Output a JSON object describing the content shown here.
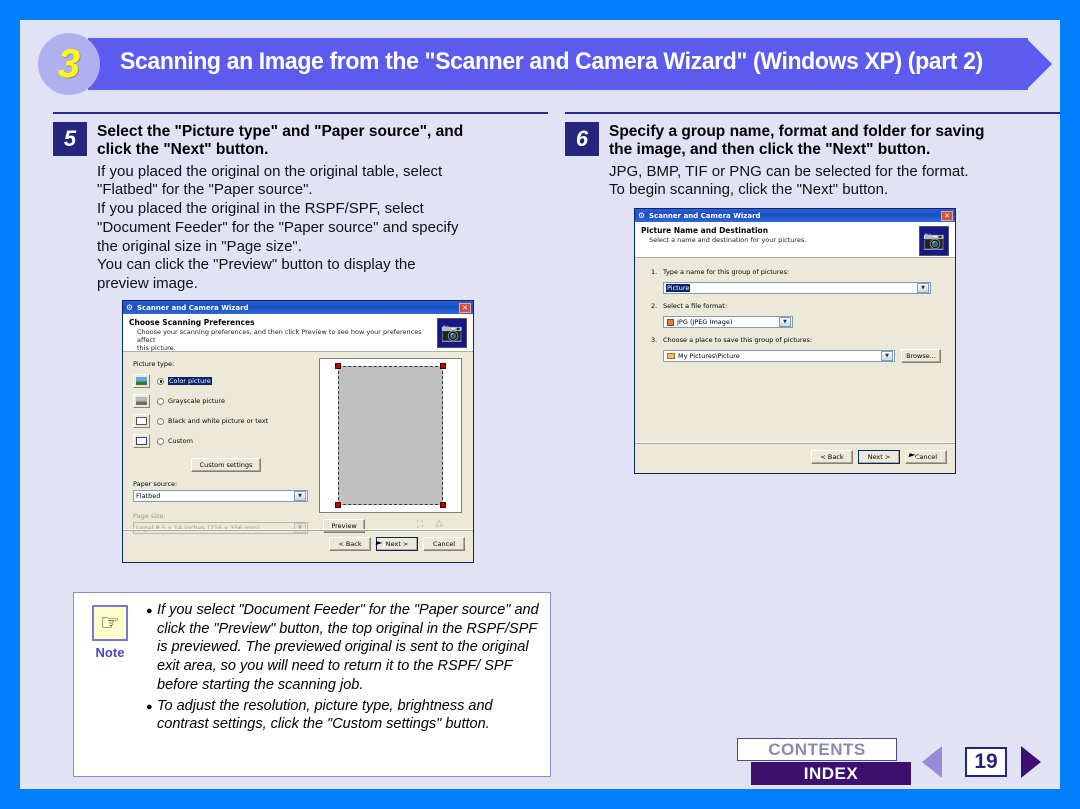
{
  "banner": {
    "number": "3",
    "title": "Scanning an Image from the \"Scanner and Camera Wizard\" (Windows XP) (part 2)",
    "accent": "#5b5bf0",
    "circle_color": "#b0b0ee",
    "number_color": "#ffff00"
  },
  "steps": [
    {
      "number": "5",
      "title_line1": "Select the \"Picture type\" and \"Paper source\", and",
      "title_line2": "click the \"Next\" button.",
      "body": [
        "If you placed the original on the original table, select",
        "\"Flatbed\" for the \"Paper source\".",
        "If you placed the original in the RSPF/SPF, select",
        "\"Document Feeder\" for the \"Paper source\" and specify",
        "the original size in \"Page size\".",
        "You can click the \"Preview\" button to display the",
        "preview image."
      ]
    },
    {
      "number": "6",
      "title_line1": "Specify a group name, format and folder for saving",
      "title_line2": "the image, and then click the \"Next\" button.",
      "body": [
        "JPG, BMP, TIF or PNG can be selected for the format.",
        "To begin scanning, click the \"Next\" button."
      ]
    }
  ],
  "dialog_scanning_preferences": {
    "title": "Scanner and Camera Wizard",
    "title_icon": "scanner-icon",
    "close_label": "✕",
    "banner_heading": "Choose Scanning Preferences",
    "banner_text_line1": "Choose your scanning preferences, and then click Preview to see how your preferences affect",
    "banner_text_line2": "this picture.",
    "banner_icon": "camera-scanner-icon",
    "picture_type_label": "Picture type:",
    "picture_types": [
      {
        "label": "Color picture",
        "selected": true,
        "icon": "color-picture-icon"
      },
      {
        "label": "Grayscale picture",
        "selected": false,
        "icon": "grayscale-picture-icon"
      },
      {
        "label": "Black and white picture or text",
        "selected": false,
        "icon": "bw-picture-icon"
      },
      {
        "label": "Custom",
        "selected": false,
        "icon": "custom-picture-icon"
      }
    ],
    "custom_settings_button": "Custom settings",
    "paper_source_label": "Paper source:",
    "paper_source_value": "Flatbed",
    "page_size_label": "Page size:",
    "page_size_value": "Legal 8.5 x 14 inches (216 x 356 mm)",
    "page_size_disabled": true,
    "preview_button": "Preview",
    "back_button": "< Back",
    "next_button": "Next >",
    "cancel_button": "Cancel",
    "toolbar_icons": [
      "zoom-selection-icon",
      "rotate-icon"
    ]
  },
  "dialog_picture_name": {
    "title": "Scanner and Camera Wizard",
    "title_icon": "scanner-icon",
    "close_label": "✕",
    "banner_heading": "Picture Name and Destination",
    "banner_text_line1": "Select a name and destination for your pictures.",
    "banner_icon": "camera-scanner-icon",
    "field1_number": "1.",
    "field1_label": "Type a name for this group of pictures:",
    "field1_value": "Picture",
    "field2_number": "2.",
    "field2_label": "Select a file format:",
    "field2_value": "JPG (JPEG Image)",
    "field2_icon": "jpg-file-icon",
    "field3_number": "3.",
    "field3_label": "Choose a place to save this group of pictures:",
    "field3_value": "My Pictures\\Picture",
    "field3_icon": "folder-icon",
    "browse_button": "Browse...",
    "back_button": "< Back",
    "next_button": "Next >",
    "cancel_button": "Cancel"
  },
  "note": {
    "label": "Note",
    "icon": "pointing-hand-icon",
    "items": [
      "If you select \"Document Feeder\" for the \"Paper source\" and click the \"Preview\" button, the top original in the RSPF/SPF is previewed. The previewed original is sent to the original exit area, so you will need to return it to the RSPF/ SPF before starting the scanning job.",
      "To adjust the resolution, picture type, brightness and contrast settings, click the \"Custom settings\" button."
    ]
  },
  "nav": {
    "contents_label": "CONTENTS",
    "index_label": "INDEX",
    "page_number": "19",
    "prev_icon": "triangle-left-icon",
    "next_icon": "triangle-right-icon"
  }
}
